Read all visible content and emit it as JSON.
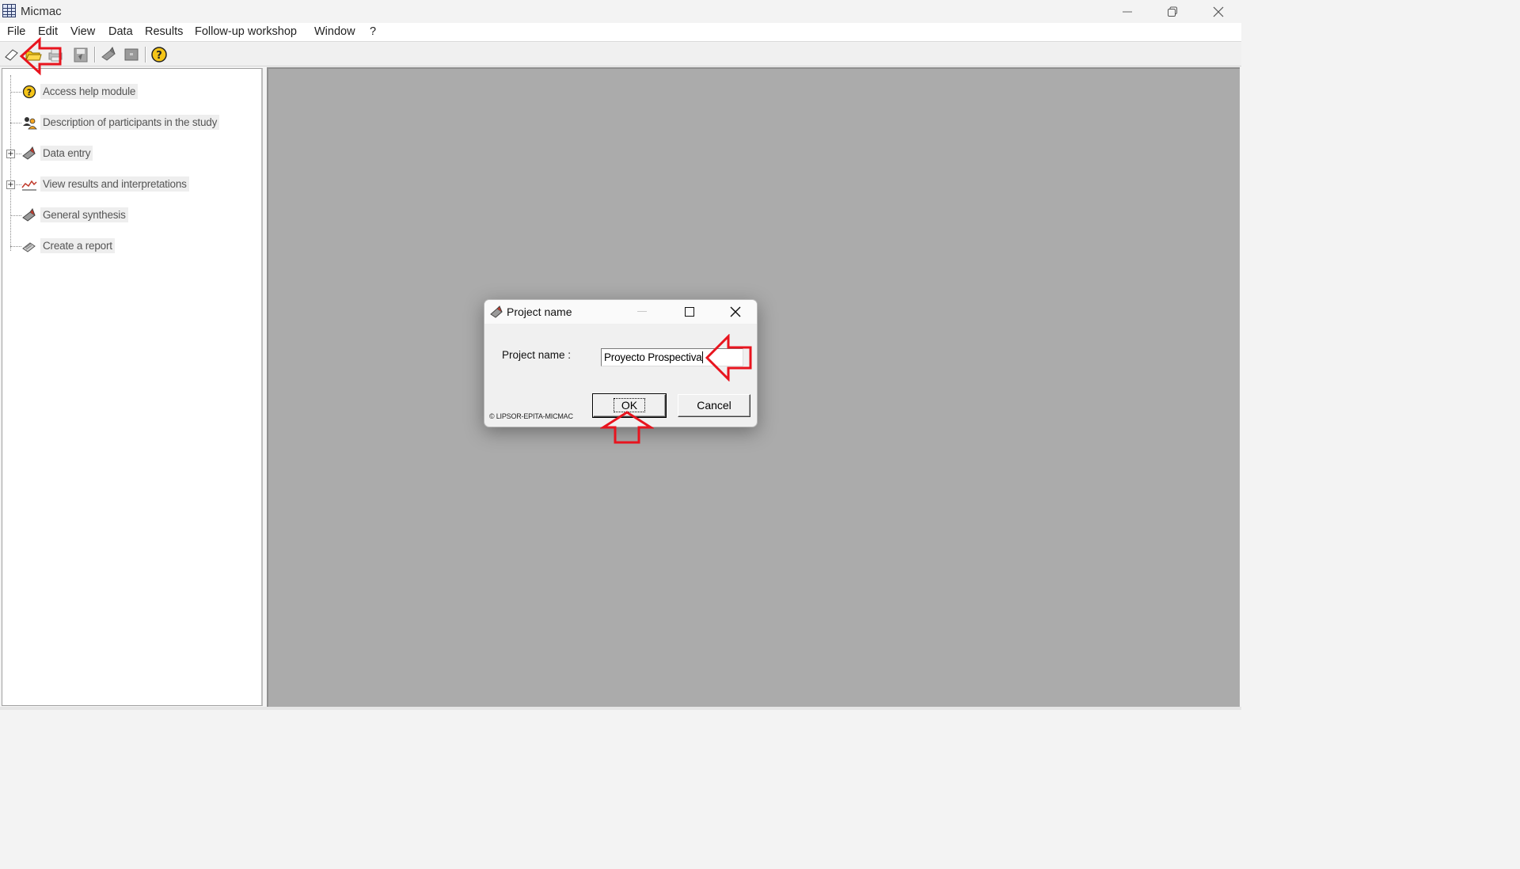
{
  "window": {
    "title": "Micmac"
  },
  "menu": {
    "items": [
      "File",
      "Edit",
      "View",
      "Data",
      "Results",
      "Follow-up workshop",
      "Window",
      "?"
    ]
  },
  "toolbar": {
    "buttons": [
      "new-file-icon",
      "open-folder-icon",
      "print-icon",
      "save-icon",
      "data-entry-icon",
      "window-icon",
      "help-icon"
    ]
  },
  "tree": {
    "items": [
      {
        "label": "Access help module",
        "icon": "help-icon",
        "expandable": false
      },
      {
        "label": "Description of participants in the study",
        "icon": "participants-icon",
        "expandable": false
      },
      {
        "label": "Data entry",
        "icon": "data-entry-icon",
        "expandable": true
      },
      {
        "label": "View results and interpretations",
        "icon": "chart-icon",
        "expandable": true
      },
      {
        "label": "General synthesis",
        "icon": "synthesis-icon",
        "expandable": false
      },
      {
        "label": "Create a report",
        "icon": "report-icon",
        "expandable": false
      }
    ],
    "expander_symbol": "+"
  },
  "dialog": {
    "title": "Project name",
    "field_label": "Project name :",
    "field_value": "Proyecto Prospectiva",
    "copyright": "© LIPSOR-EPITA-MICMAC",
    "ok_label": "OK",
    "cancel_label": "Cancel"
  },
  "colors": {
    "annotation_red": "#e8141e",
    "mdi_background": "#ababab",
    "tree_label_bg": "#eeeeee"
  }
}
